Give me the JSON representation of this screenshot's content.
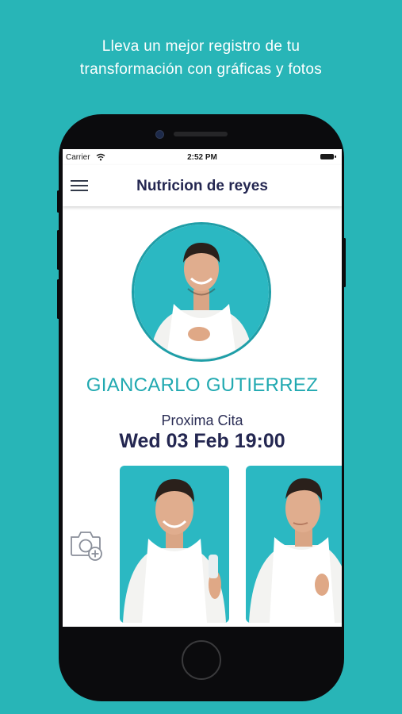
{
  "promo": {
    "line1": "Lleva un mejor registro de tu",
    "line2": "transformación con gráficas y fotos"
  },
  "statusbar": {
    "carrier": "Carrier",
    "time": "2:52 PM"
  },
  "app": {
    "title": "Nutricion de reyes"
  },
  "profile": {
    "name": "GIANCARLO GUTIERREZ"
  },
  "appointment": {
    "label": "Proxima Cita",
    "value": "Wed 03 Feb 19:00"
  },
  "colors": {
    "background": "#28b5b7",
    "accent": "#21a9b1",
    "title_navy": "#242751",
    "photo_backdrop": "#2bb8c2"
  },
  "icons": [
    "menu-icon",
    "camera-plus-icon",
    "wifi-icon",
    "battery-icon"
  ]
}
